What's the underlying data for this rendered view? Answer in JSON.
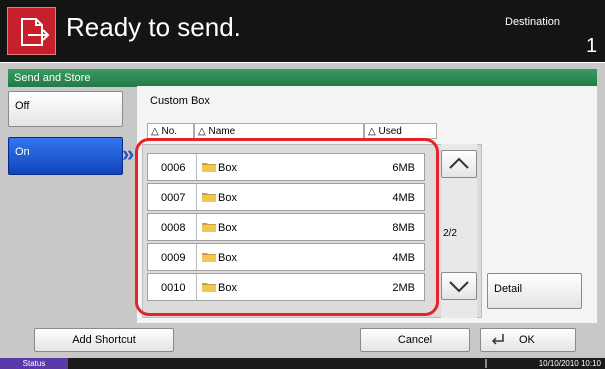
{
  "header": {
    "title": "Ready to send.",
    "destination_label": "Destination",
    "destination_count": "1"
  },
  "panel": {
    "section_title": "Send and Store",
    "off_label": "Off",
    "on_label": "On",
    "selected": "On",
    "box_label": "Custom Box",
    "columns": {
      "no": "No.",
      "name": "Name",
      "used": "Used"
    },
    "rows": [
      {
        "no": "0006",
        "name": "Box",
        "used": "6MB"
      },
      {
        "no": "0007",
        "name": "Box",
        "used": "4MB"
      },
      {
        "no": "0008",
        "name": "Box",
        "used": "8MB"
      },
      {
        "no": "0009",
        "name": "Box",
        "used": "4MB"
      },
      {
        "no": "0010",
        "name": "Box",
        "used": "2MB"
      }
    ],
    "page_indicator": "2/2",
    "detail_label": "Detail"
  },
  "footer": {
    "add_shortcut_label": "Add Shortcut",
    "cancel_label": "Cancel",
    "ok_label": "OK"
  },
  "statusbar": {
    "status_label": "Status",
    "datetime": "10/10/2010   10:10"
  },
  "colors": {
    "accent_red": "#c8202a",
    "section_green": "#237a48",
    "selected_blue": "#1144bb",
    "status_purple": "#5b39a8",
    "highlight_outline": "#e8202a"
  }
}
